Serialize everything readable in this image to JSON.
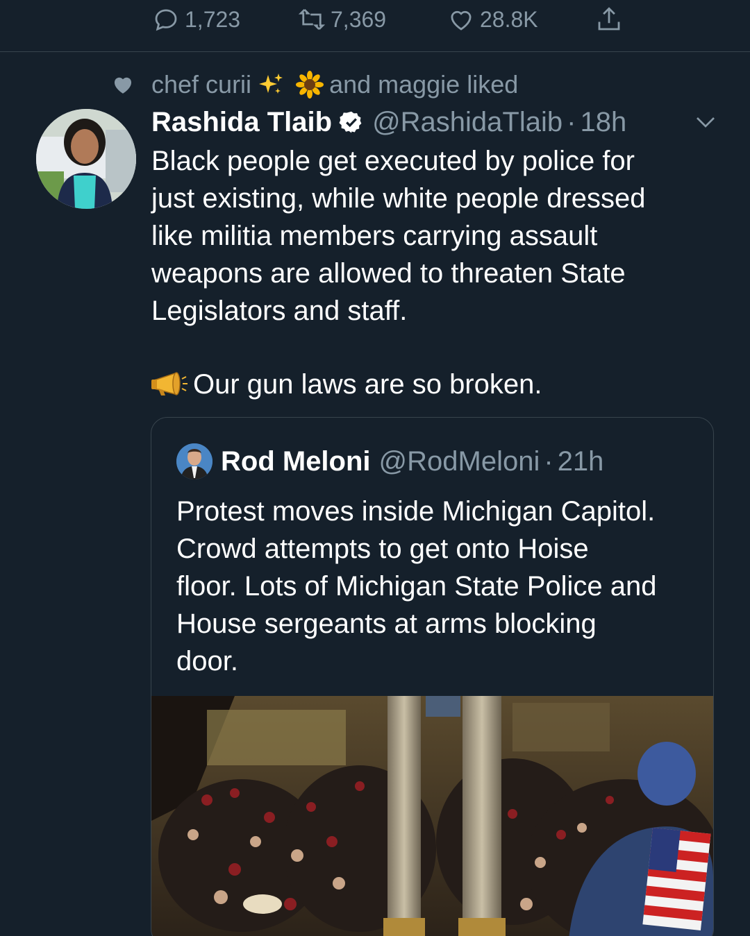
{
  "prev_actions": {
    "reply_count": "1,723",
    "retweet_count": "7,369",
    "like_count": "28.8K"
  },
  "social_context": {
    "user1": "chef curii",
    "emoji1": "sparkles",
    "emoji2": "sunflower",
    "rest": "and maggie liked"
  },
  "tweet": {
    "author_name": "Rashida Tlaib",
    "handle": "@RashidaTlaib",
    "separator": "·",
    "time": "18h",
    "text_line1": "Black people get executed by police for",
    "text_line2": "just existing, while white people dressed",
    "text_line3": "like militia members carrying assault",
    "text_line4": "weapons are allowed to threaten State",
    "text_line5": "Legislators and staff.",
    "text_second": "Our gun laws are so broken.",
    "second_emoji": "megaphone"
  },
  "quoted": {
    "author_name": "Rod Meloni",
    "handle": "@RodMeloni",
    "separator": "·",
    "time": "21h",
    "line1": "Protest moves inside Michigan Capitol.",
    "line2": "Crowd attempts to get onto Hoise",
    "line3": "floor. Lots of Michigan State Police and",
    "line4": "House sergeants at arms blocking",
    "line5": "door."
  },
  "colors": {
    "background": "#15202b",
    "secondary_text": "#8899a6",
    "border": "#38444d"
  }
}
